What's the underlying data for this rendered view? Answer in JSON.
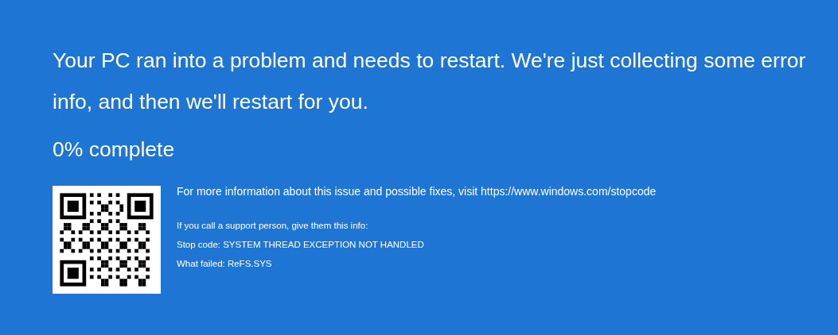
{
  "message": "Your PC ran into a problem and needs to restart. We're just collecting some error info, and then we'll restart for you.",
  "progress": "0% complete",
  "more_info": "For more information about this issue and possible fixes, visit https://www.windows.com/stopcode",
  "support_lines": [
    "If you call a support person, give them this info:",
    "Stop code: SYSTEM THREAD EXCEPTION NOT HANDLED",
    "What failed: ReFS.SYS"
  ]
}
